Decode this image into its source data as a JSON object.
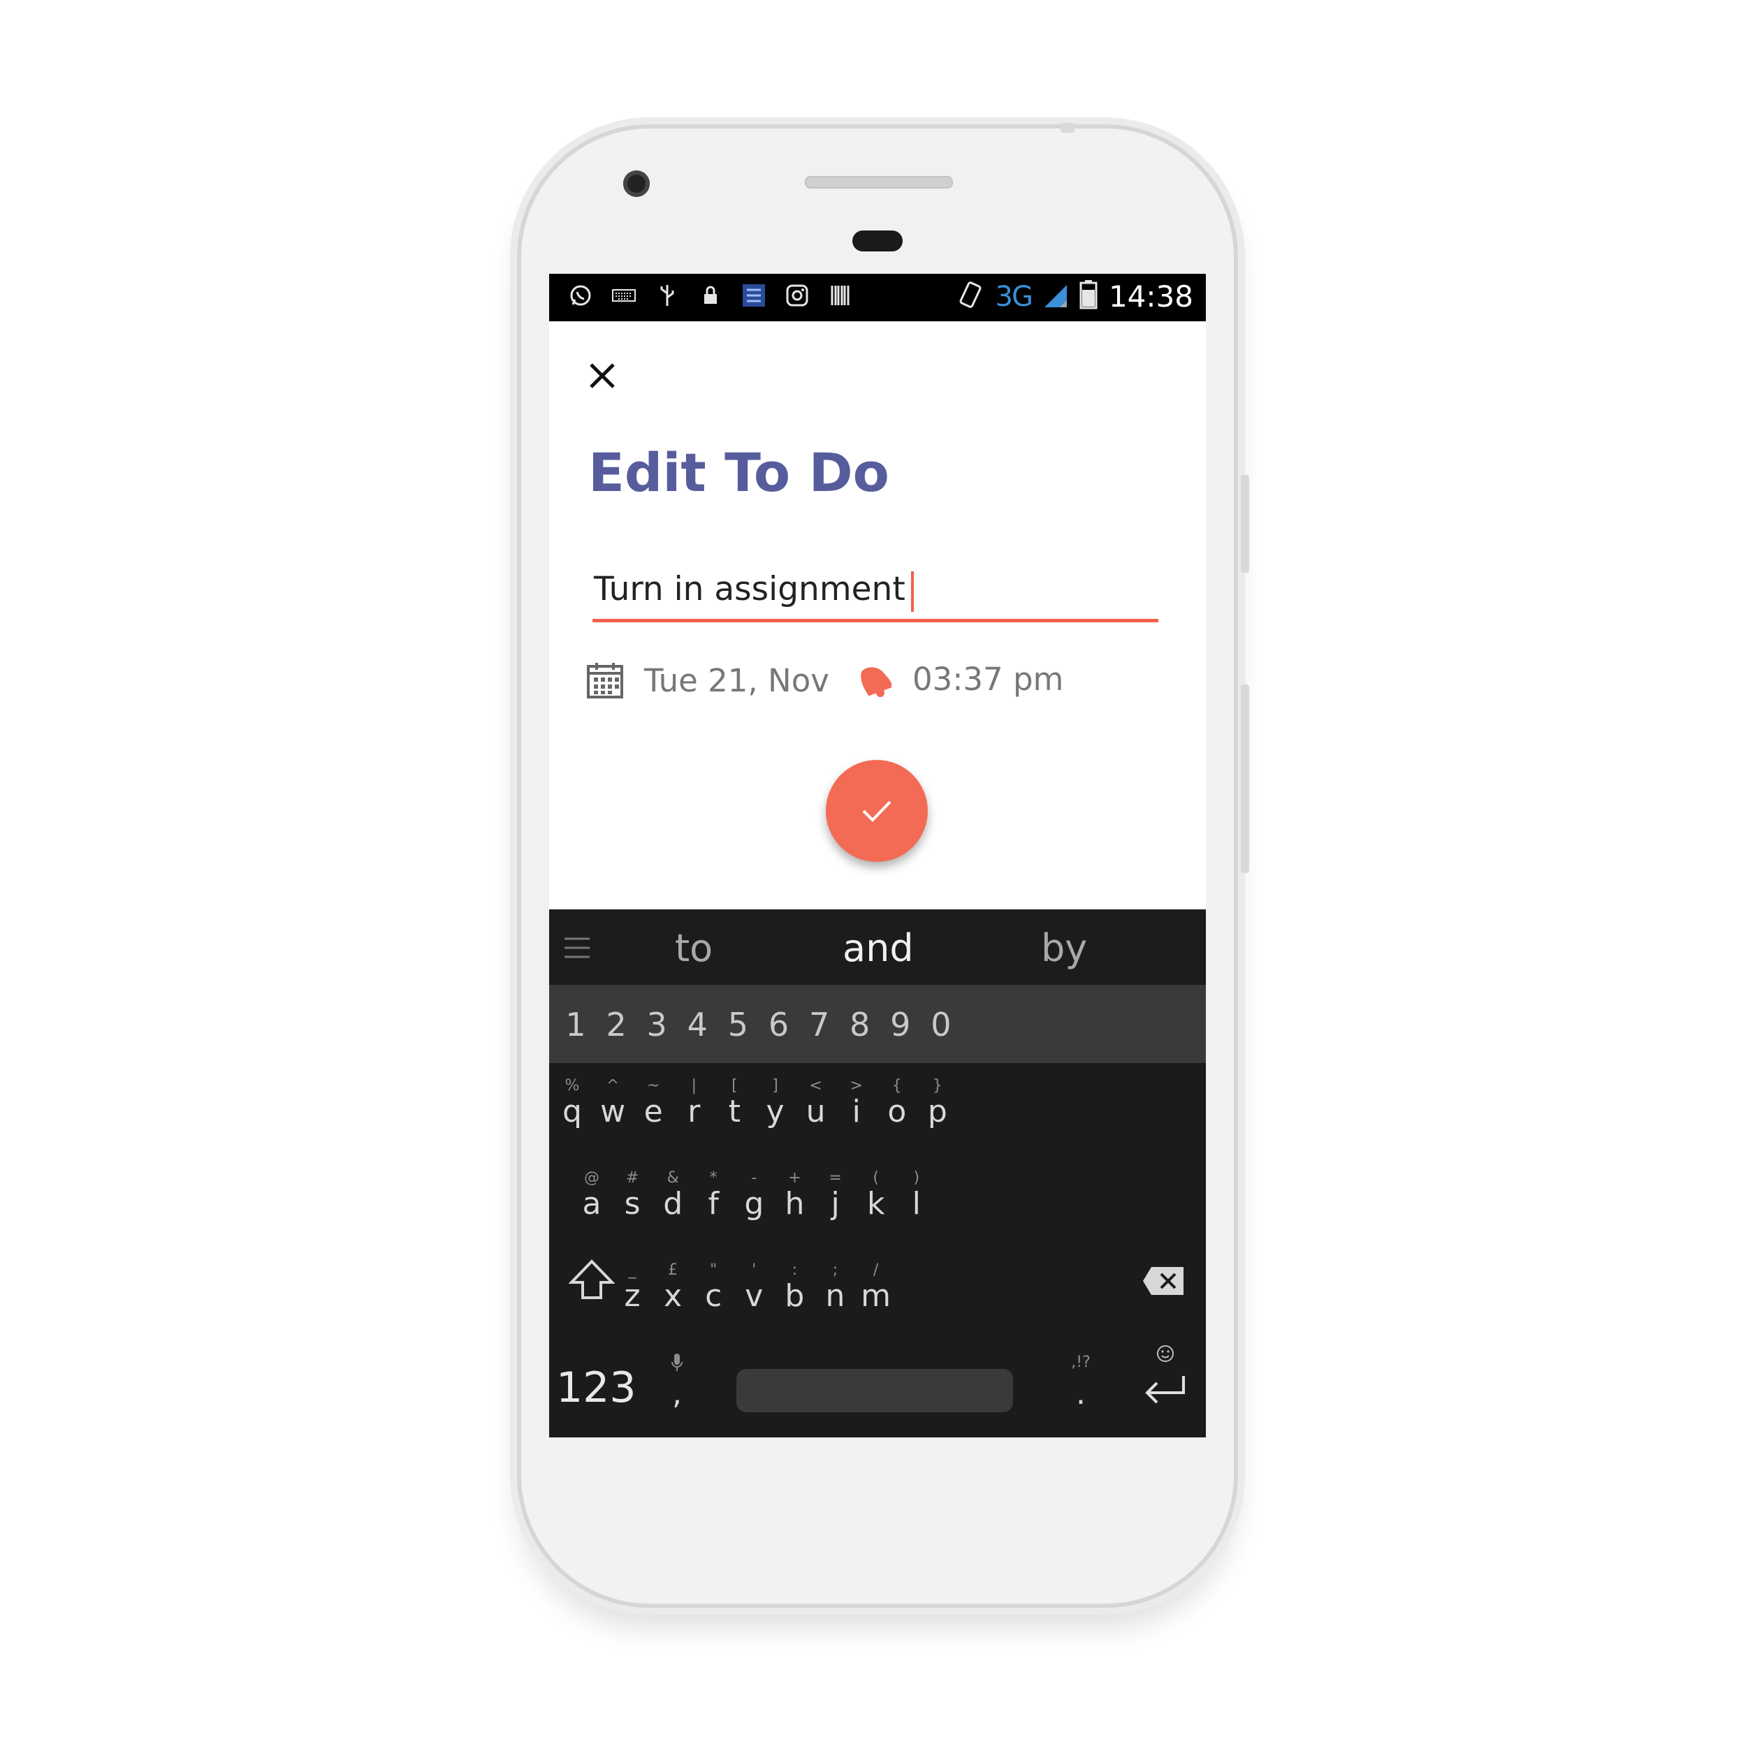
{
  "statusbar": {
    "icons": [
      "whatsapp-icon",
      "keyboard-icon",
      "usb-icon",
      "lock-icon",
      "task-list-icon",
      "instagram-icon",
      "barcode-icon"
    ],
    "network": "3G",
    "time": "14:38"
  },
  "header": {
    "title": "Edit To Do"
  },
  "task": {
    "value": "Turn in assignment"
  },
  "reminder": {
    "date": "Tue 21, Nov",
    "time": "03:37 pm"
  },
  "colors": {
    "accent": "#f36b55",
    "title": "#565c9c"
  },
  "keyboard": {
    "suggestions": [
      "to",
      "and",
      "by"
    ],
    "numbers": [
      "1",
      "2",
      "3",
      "4",
      "5",
      "6",
      "7",
      "8",
      "9",
      "0"
    ],
    "row1": [
      {
        "alt": "%",
        "main": "q"
      },
      {
        "alt": "^",
        "main": "w"
      },
      {
        "alt": "~",
        "main": "e"
      },
      {
        "alt": "|",
        "main": "r"
      },
      {
        "alt": "[",
        "main": "t"
      },
      {
        "alt": "]",
        "main": "y"
      },
      {
        "alt": "<",
        "main": "u"
      },
      {
        "alt": ">",
        "main": "i"
      },
      {
        "alt": "{",
        "main": "o"
      },
      {
        "alt": "}",
        "main": "p"
      }
    ],
    "row2": [
      {
        "alt": "@",
        "main": "a"
      },
      {
        "alt": "#",
        "main": "s"
      },
      {
        "alt": "&",
        "main": "d"
      },
      {
        "alt": "*",
        "main": "f"
      },
      {
        "alt": "-",
        "main": "g"
      },
      {
        "alt": "+",
        "main": "h"
      },
      {
        "alt": "=",
        "main": "j"
      },
      {
        "alt": "(",
        "main": "k"
      },
      {
        "alt": ")",
        "main": "l"
      }
    ],
    "row3": [
      {
        "alt": "_",
        "main": "z"
      },
      {
        "alt": "£",
        "main": "x"
      },
      {
        "alt": "\"",
        "main": "c"
      },
      {
        "alt": "'",
        "main": "v"
      },
      {
        "alt": ":",
        "main": "b"
      },
      {
        "alt": ";",
        "main": "n"
      },
      {
        "alt": "/",
        "main": "m"
      }
    ],
    "symbols_key": "123",
    "comma": ",",
    "period": ".",
    "period_alt": ",!?"
  }
}
